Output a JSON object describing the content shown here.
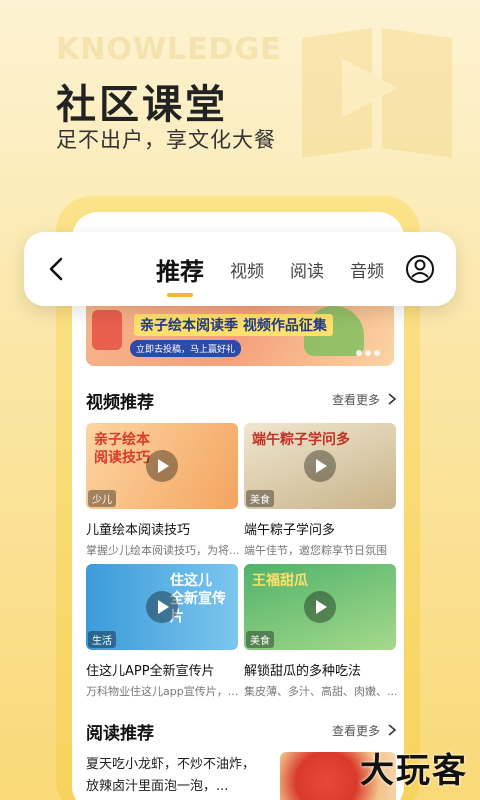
{
  "hero": {
    "bg_word": "KNOWLEDGE",
    "title": "社区课堂",
    "subtitle": "足不出户，享文化大餐"
  },
  "nav": {
    "tabs": [
      "推荐",
      "视频",
      "阅读",
      "音频"
    ],
    "active_tab": "推荐"
  },
  "banner": {
    "title": "亲子绘本阅读季 视频作品征集",
    "subtitle": "立即去投稿，马上赢好礼"
  },
  "video_section": {
    "title": "视频推荐",
    "see_more": "查看更多",
    "cards": [
      {
        "thumb_text": "亲子绘本\n阅读技巧",
        "tag": "少儿",
        "title": "儿童绘本阅读技巧",
        "desc": "掌握少儿绘本阅读技巧，为将..."
      },
      {
        "thumb_text": "端午粽子学问多",
        "tag": "美食",
        "title": "端午粽子学问多",
        "desc": "端午佳节，邀您粽享节日氛围"
      },
      {
        "thumb_text": "住这儿\n全新宣传片",
        "tag": "生活",
        "title": "住这儿APP全新宣传片",
        "desc": "万科物业住这儿app宣传片，..."
      },
      {
        "thumb_text": "王福甜瓜",
        "tag": "美食",
        "title": "解锁甜瓜的多种吃法",
        "desc": "集皮薄、多汁、高甜、肉嫩、..."
      }
    ]
  },
  "reading_section": {
    "title": "阅读推荐",
    "see_more": "查看更多",
    "article_text": "夏天吃小龙虾，不炒不油炸，放辣卤汁里面泡一泡，..."
  },
  "watermark": "大玩客",
  "colors": {
    "accent": "#f2b830",
    "frame": "#f7d25c"
  }
}
